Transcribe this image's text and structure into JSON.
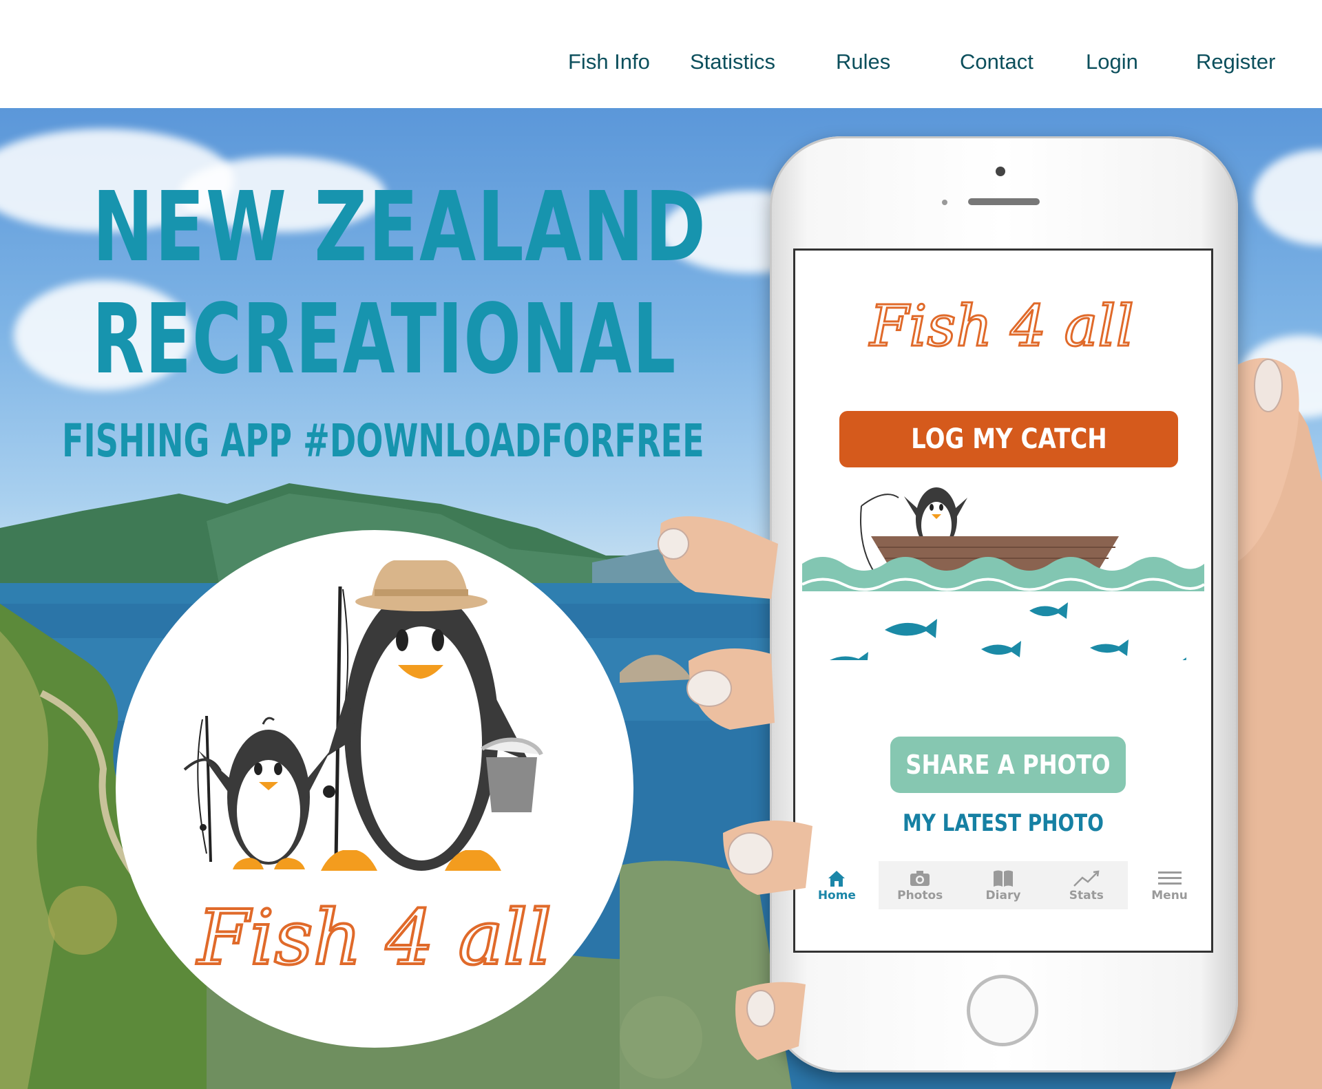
{
  "nav": {
    "items": [
      "Fish Info",
      "Statistics",
      "Rules",
      "Contact",
      "Login",
      "Register"
    ]
  },
  "hero": {
    "line1": "NEW ZEALAND",
    "line2": "RECREATIONAL",
    "line3": "FISHING APP #DOWNLOADFORFREE"
  },
  "logo": {
    "wordmark": "Fish 4 all"
  },
  "app": {
    "brand": "Fish 4 all",
    "log_catch": "LOG MY CATCH",
    "share_photo": "SHARE A PHOTO",
    "latest_photo": "MY LATEST PHOTO",
    "tabs": [
      {
        "label": "Home",
        "icon": "home-icon"
      },
      {
        "label": "Photos",
        "icon": "camera-icon"
      },
      {
        "label": "Diary",
        "icon": "book-icon"
      },
      {
        "label": "Stats",
        "icon": "trend-icon"
      },
      {
        "label": "Menu",
        "icon": "menu-icon"
      }
    ]
  },
  "colors": {
    "nav_text": "#0c4f5c",
    "headline": "#1794ae",
    "brand_orange": "#e06a2a",
    "log_button": "#d55a1c",
    "share_button": "#86c7b1",
    "latest_photo": "#1680a3",
    "fish": "#1b8aa6",
    "wave": "#82c6b2",
    "tab_active": "#1b86a8"
  }
}
